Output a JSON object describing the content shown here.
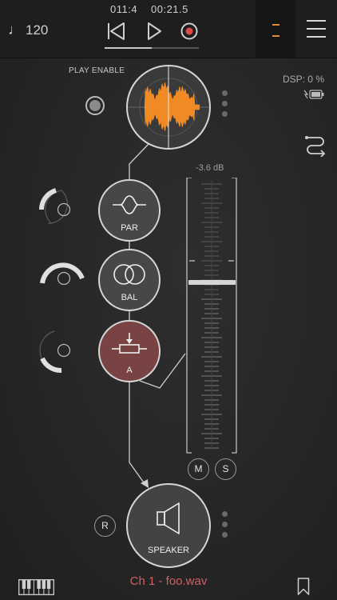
{
  "transport": {
    "tempo": "120",
    "tempo_glyph": "♩",
    "position": "011:4",
    "time": "00:21.5",
    "progress_fraction": 0.5
  },
  "node_labels": {
    "play_enable": "PLAY ENABLE",
    "par": "PAR",
    "bal": "BAL",
    "a": "A",
    "speaker": "SPEAKER"
  },
  "dsp": "DSP:  0 %",
  "fader": {
    "db_label": "-3.6 dB",
    "level_fraction": 0.62,
    "m_label": "M",
    "s_label": "S"
  },
  "r_label": "R",
  "channel": "Ch 1 - foo.wav",
  "icons": {
    "tempo": "quarter-note",
    "previous": "skip-previous-icon",
    "play": "play-icon",
    "record": "record-icon",
    "menu": "hamburger-menu-icon",
    "route": "route-icon",
    "battery": "battery-charging-icon",
    "keyboard": "piano-keyboard-icon",
    "bookmark": "bookmark-icon",
    "speaker": "speaker-icon"
  },
  "colors": {
    "waveform": "#f08a24",
    "record": "#e04a4a",
    "active_node": "#7a4343",
    "channel_text": "#d05f63",
    "meter_accent": "#e88a2b"
  }
}
